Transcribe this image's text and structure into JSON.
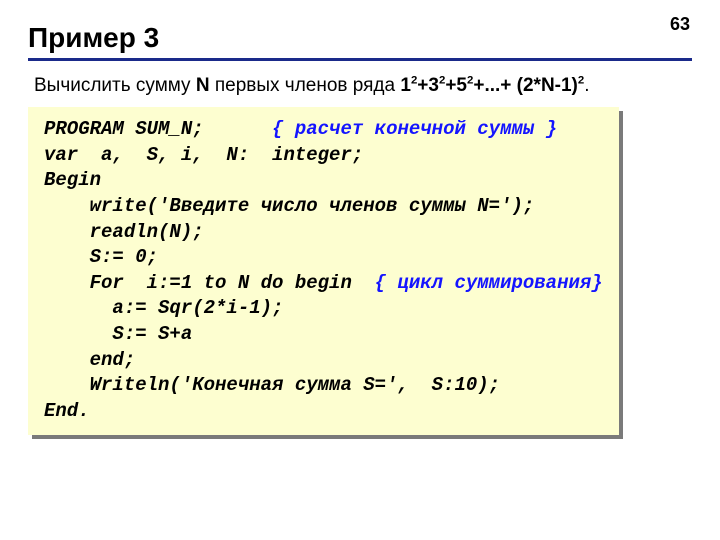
{
  "page_number": "63",
  "title": "Пример 3",
  "problem": {
    "prefix": "Вычислить сумму ",
    "N": "N",
    "mid": " первых членов ряда ",
    "series": {
      "t1_base": "1",
      "t1_exp": "2",
      "t2_base": "3",
      "t2_exp": "2",
      "t3_base": "5",
      "t3_exp": "2",
      "dots": "+...+",
      "last": "(2*N-1)",
      "last_exp": "2"
    },
    "end": "."
  },
  "code": {
    "l01a": "PROGRAM SUM_N;      ",
    "l01b": "{ расчет конечной суммы }",
    "l02": "var  a,  S, i,  N:  integer;",
    "l03": "Begin",
    "l04": "    write('Введите число членов суммы N=');",
    "l05": "    readln(N);",
    "l06": "    S:= 0;",
    "l07a": "    For  i:=1 to N do begin  ",
    "l07b": "{ цикл суммирования}",
    "l08": "      a:= Sqr(2*i-1);",
    "l09": "      S:= S+a",
    "l10": "    end;",
    "l11": "    Writeln('Конечная сумма S=',  S:10);",
    "l12": "End."
  }
}
